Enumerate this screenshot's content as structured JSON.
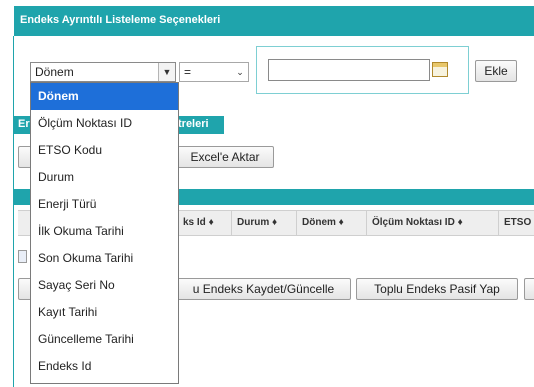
{
  "header": {
    "title": "Endeks Ayrıntılı Listeleme Seçenekleri"
  },
  "filter": {
    "field_value": "Dönem",
    "operator_value": "=",
    "text_value": "",
    "ekle_label": "Ekle"
  },
  "tabs": {
    "partial_left": "Er",
    "partial_right": "treleri"
  },
  "toolbar": {
    "excel_label": "Excel'e Aktar"
  },
  "grid": {
    "columns": [
      "ks Id ♦",
      "Durum ♦",
      "Dönem ♦",
      "Ölçüm Noktası ID ♦",
      "ETSO"
    ]
  },
  "actions": {
    "save_label": "u Endeks Kaydet/Güncelle",
    "passive_label": "Toplu Endeks Pasif Yap"
  },
  "dropdown": {
    "selected_index": 0,
    "options": [
      "Dönem",
      "Ölçüm Noktası ID",
      "ETSO Kodu",
      "Durum",
      "Enerji Türü",
      "İlk Okuma Tarihi",
      "Son Okuma Tarihi",
      "Sayaç Seri No",
      "Kayıt Tarihi",
      "Güncelleme Tarihi",
      "Endeks Id"
    ]
  },
  "colors": {
    "accent": "#1fa4ac",
    "selection": "#1e6fd9"
  }
}
